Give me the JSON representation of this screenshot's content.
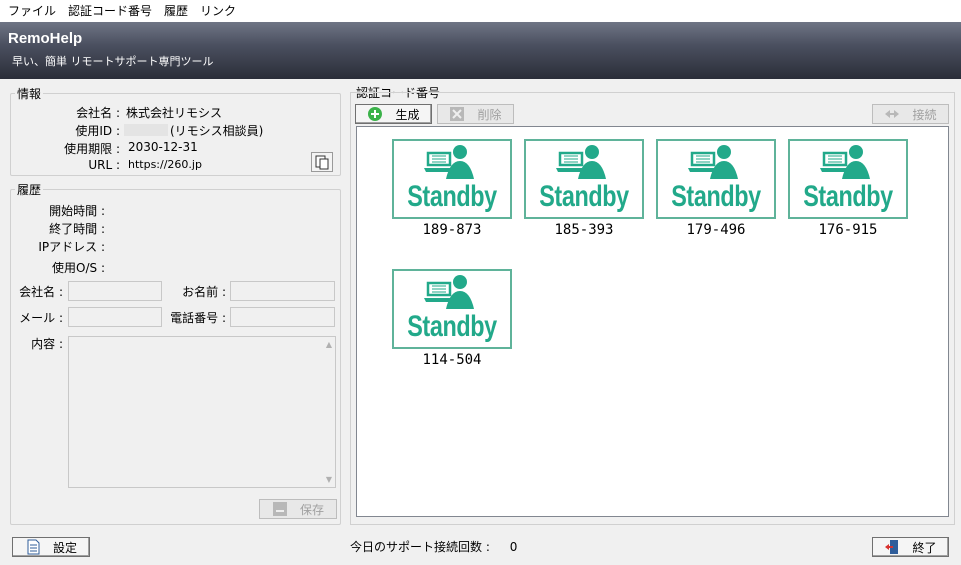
{
  "menu": [
    "ファイル",
    "認証コード番号",
    "履歴",
    "リンク"
  ],
  "app": {
    "title": "RemoHelp",
    "subtitle": "早い、簡単 リモートサポート専門ツール"
  },
  "info": {
    "legend": "情報",
    "company_label": "会社名 :",
    "company_value": "株式会社リモシス",
    "user_id_label": "使用ID :",
    "user_id_value": "(リモシス相談員)",
    "expiry_label": "使用期限 :",
    "expiry_value": "2030-12-31",
    "url_label": "URL :",
    "url_value": "https://260.jp"
  },
  "history": {
    "legend": "履歴",
    "start_label": "開始時間 :",
    "end_label": "終了時間 :",
    "ip_label": "IPアドレス :",
    "os_label": "使用O/S :",
    "company_label": "会社名 :",
    "name_label": "お名前 :",
    "mail_label": "メール :",
    "phone_label": "電話番号 :",
    "content_label": "内容 :",
    "save_label": "保存"
  },
  "codes": {
    "legend": "認証コード番号",
    "generate_label": "生成",
    "delete_label": "削除",
    "connect_label": "接続",
    "standby_text": "Standby",
    "items": [
      "189-873",
      "185-393",
      "179-496",
      "176-915",
      "114-504"
    ]
  },
  "footer": {
    "settings_label": "設定",
    "status_label": "今日のサポート接続回数 :",
    "status_value": "0",
    "exit_label": "終了"
  },
  "colors": {
    "standby_green": "#22a98a",
    "card_border": "#5fb39a",
    "banner_dark": "#2a2d38"
  }
}
